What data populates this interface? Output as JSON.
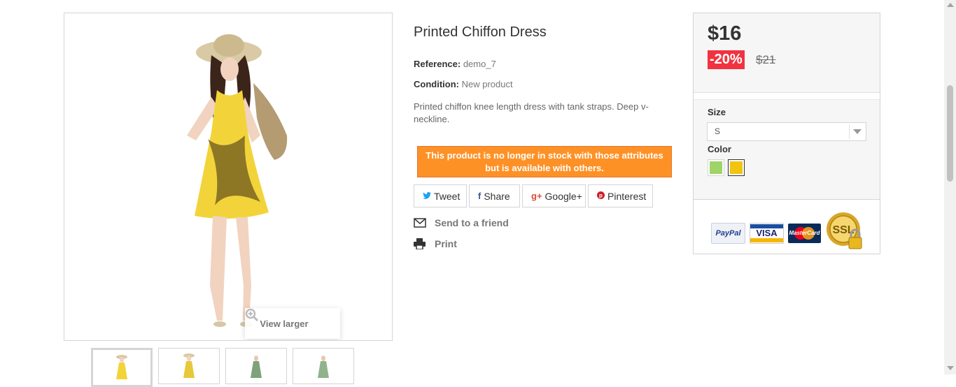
{
  "product": {
    "title": "Printed Chiffon Dress",
    "reference_label": "Reference:",
    "reference_value": "demo_7",
    "condition_label": "Condition:",
    "condition_value": "New product",
    "description": "Printed chiffon knee length dress with tank straps. Deep v-neckline.",
    "stock_warning": "This product is no longer in stock with those attributes but is available with others."
  },
  "image": {
    "view_larger_label": "View larger",
    "thumbnail_count": 4
  },
  "social": {
    "tweet": "Tweet",
    "share": "Share",
    "google": "Google+",
    "pinterest": "Pinterest"
  },
  "actions": {
    "send_to_friend": "Send to a friend",
    "print": "Print"
  },
  "buy_box": {
    "price": "$16",
    "reduction": "-20%",
    "old_price": "$21",
    "size_label": "Size",
    "size_selected": "S",
    "color_label": "Color",
    "colors": [
      {
        "name": "green",
        "hex": "#a0d468"
      },
      {
        "name": "yellow",
        "hex": "#f1c40f"
      }
    ],
    "selected_color": "yellow",
    "payment_methods": [
      "PayPal",
      "VISA",
      "MasterCard",
      "SSL"
    ]
  },
  "colors": {
    "warning_orange": "#fe9126",
    "reduction_red": "#f13340"
  }
}
